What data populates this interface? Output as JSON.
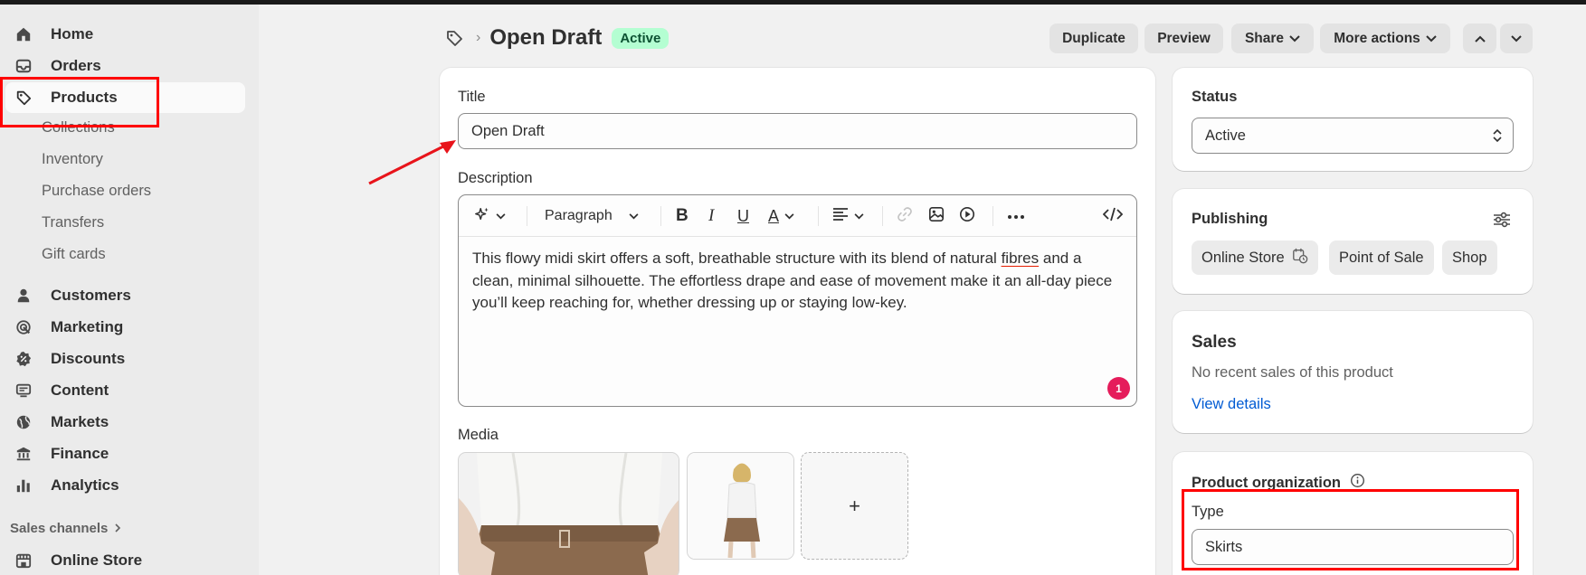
{
  "sidebar": {
    "main": [
      {
        "label": "Home",
        "icon": "home-icon"
      },
      {
        "label": "Orders",
        "icon": "inbox-icon"
      },
      {
        "label": "Products",
        "icon": "tag-icon"
      }
    ],
    "products_sub": [
      "Collections",
      "Inventory",
      "Purchase orders",
      "Transfers",
      "Gift cards"
    ],
    "more": [
      {
        "label": "Customers",
        "icon": "person-icon"
      },
      {
        "label": "Marketing",
        "icon": "target-icon"
      },
      {
        "label": "Discounts",
        "icon": "discount-icon"
      },
      {
        "label": "Content",
        "icon": "content-icon"
      },
      {
        "label": "Markets",
        "icon": "globe-icon"
      },
      {
        "label": "Finance",
        "icon": "bank-icon"
      },
      {
        "label": "Analytics",
        "icon": "bar-chart-icon"
      }
    ],
    "sales_channels_label": "Sales channels",
    "online_store_label": "Online Store"
  },
  "header": {
    "title": "Open Draft",
    "status_badge": "Active",
    "buttons": {
      "duplicate": "Duplicate",
      "preview": "Preview",
      "share": "Share",
      "more_actions": "More actions"
    }
  },
  "product": {
    "title_label": "Title",
    "title_value": "Open Draft",
    "description_label": "Description",
    "paragraph_select": "Paragraph",
    "description_parts": {
      "before": "This flowy midi skirt offers a soft, breathable structure with its blend of natural ",
      "misspelled": "fibres",
      "after": " and a clean, minimal silhouette. The effortless drape and ease of movement make it an all-day piece you’ll keep reaching for, whether dressing up or staying low-key."
    },
    "notification_count": "1",
    "media_label": "Media",
    "add_media": "+"
  },
  "status_card": {
    "title": "Status",
    "value": "Active"
  },
  "publishing": {
    "title": "Publishing",
    "channels": [
      "Online Store",
      "Point of Sale",
      "Shop"
    ]
  },
  "sales": {
    "title": "Sales",
    "text": "No recent sales of this product",
    "link": "View details"
  },
  "organization": {
    "title": "Product organization",
    "type_label": "Type",
    "type_value": "Skirts"
  },
  "colors": {
    "annotation": "#ff0000",
    "active_badge_bg": "#b4fed2",
    "link": "#005bd3"
  }
}
